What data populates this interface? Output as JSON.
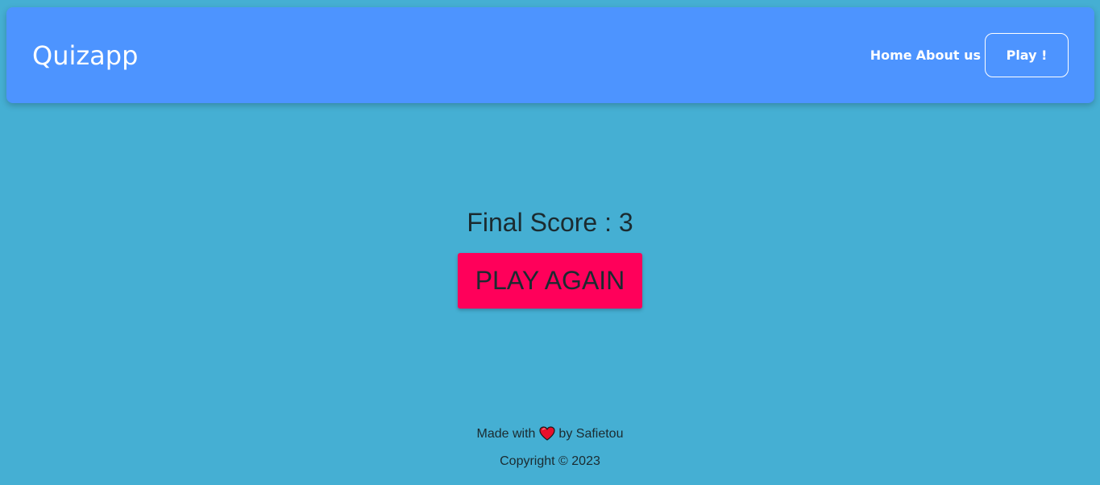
{
  "navbar": {
    "brand": "Quizapp",
    "links": [
      {
        "label": "Home"
      },
      {
        "label": "About us"
      }
    ],
    "play_label": "Play !"
  },
  "main": {
    "score_text": "Final Score : 3",
    "play_again_label": "PLAY AGAIN"
  },
  "footer": {
    "made_with": "Made with",
    "by_text": "by Safietou",
    "heart_icon": "heart-icon",
    "copyright": "Copyright © 2023"
  },
  "colors": {
    "background": "#45afd3",
    "navbar": "#4d94ff",
    "play_again_button": "#ff005a",
    "text_dark": "#1b2b30"
  }
}
